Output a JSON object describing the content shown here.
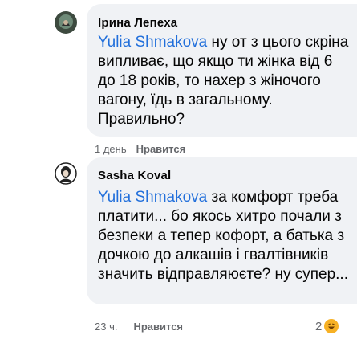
{
  "comments": [
    {
      "author": "Ірина Лепеха",
      "mention": "Yulia Shmakova",
      "text": " ну от з цього скріна випливає, що якщо ти жінка від 6 до 18 років, то нахер з жіночого вагону, їдь в загальному. Правильно?",
      "time": "1 день",
      "like_label": "Нравится"
    },
    {
      "author": "Sasha Koval",
      "mention": "Yulia Shmakova",
      "text": " за комфорт треба платити... бо якось хитро почали з безпеки а тепер кофорт, а батька з дочкою до алкашів і гвалтівників значить відправляюєте? ну супер...",
      "time": "23 ч.",
      "like_label": "Нравится",
      "reaction_count": "2",
      "reaction_icon": "haha-emoji-icon"
    }
  ],
  "colors": {
    "bubble": "#f0f2f5",
    "mention": "#216fdb",
    "meta": "#65676b"
  }
}
